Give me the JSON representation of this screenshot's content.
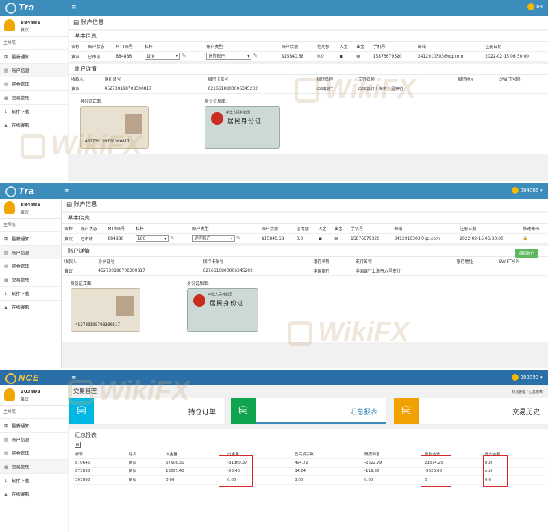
{
  "panel1": {
    "brand": "Tra",
    "user_top": "88",
    "sidebar": {
      "user_id": "884886",
      "user_name": "黄议",
      "nav_header": "主导航",
      "items": [
        {
          "icon": "bullhorn-icon",
          "glyph": "◘",
          "label": "最新通知"
        },
        {
          "icon": "id-card-icon",
          "glyph": "▤",
          "label": "账户信息"
        },
        {
          "icon": "money-icon",
          "glyph": "▥",
          "label": "资金管理"
        },
        {
          "icon": "chart-icon",
          "glyph": "▦",
          "label": "交易管理"
        },
        {
          "icon": "download-icon",
          "glyph": "↓",
          "label": "软件下载"
        },
        {
          "icon": "user-icon",
          "glyph": "▲",
          "label": "在线客服"
        }
      ]
    },
    "page_title": "账户信息",
    "basic": {
      "title": "基本信息",
      "headers": [
        "名称",
        "账户状态",
        "MT4账号",
        "杠杆",
        "账户类型",
        "账户余额",
        "信用额",
        "入金",
        "出金",
        "手机号",
        "邮箱",
        "注册日期"
      ],
      "row": {
        "name": "黄议",
        "status": "已审核",
        "mt4": "884886",
        "leverage": "100",
        "type": "迷你账户",
        "balance": "$15840.68",
        "credit": "0.0",
        "phone": "15876679320",
        "email": "3412910303@qq.com",
        "reg": "2022-02-15 06:30:00"
      }
    },
    "detail": {
      "title": "账户详情",
      "headers": [
        "收款人",
        "身份证号",
        "银行卡账号",
        "银行名称",
        "支行名称",
        "银行地址",
        "SWIFT号码"
      ],
      "row": {
        "payee": "黄议",
        "idno": "452730198708300817",
        "card": "6216610800006345202",
        "bank": "中国银行",
        "branch": "中国银行上海市六里支行",
        "addr": "",
        "swift": ""
      },
      "front_label": "身份证正面:",
      "back_label": "身份证反面:",
      "card_number": "452730198708300817",
      "back_title": "居民身份证",
      "back_sub": "中华人民共和国"
    }
  },
  "panel2": {
    "brand": "Tra",
    "user_top": "884886",
    "sidebar": {
      "user_id": "884886",
      "user_name": "黄议",
      "nav_header": "主导航",
      "items": [
        {
          "icon": "bullhorn-icon",
          "glyph": "◘",
          "label": "最新通知"
        },
        {
          "icon": "id-card-icon",
          "glyph": "▤",
          "label": "账户信息"
        },
        {
          "icon": "money-icon",
          "glyph": "▥",
          "label": "资金管理"
        },
        {
          "icon": "chart-icon",
          "glyph": "▦",
          "label": "交易管理"
        },
        {
          "icon": "download-icon",
          "glyph": "↓",
          "label": "软件下载"
        },
        {
          "icon": "user-icon",
          "glyph": "▲",
          "label": "在线客服"
        }
      ]
    },
    "page_title": "账户信息",
    "basic": {
      "title": "基本信息",
      "headers": [
        "名称",
        "账户状态",
        "MT4账号",
        "杠杆",
        "账户类型",
        "账户余额",
        "信用额",
        "入金",
        "出金",
        "手机号",
        "邮箱",
        "注册日期",
        "修改密码"
      ],
      "row": {
        "name": "黄议",
        "status": "已审核",
        "mt4": "884886",
        "leverage": "100",
        "type": "迷你账户",
        "balance": "$15840.68",
        "credit": "0.0",
        "phone": "15876679320",
        "email": "3412910303@qq.com",
        "reg": "2022-02-15 06:30:00"
      }
    },
    "detail": {
      "title": "账户详情",
      "button": "编辑账户",
      "headers": [
        "收款人",
        "身份证号",
        "银行卡账号",
        "银行名称",
        "支行名称",
        "银行地址",
        "SWIFT号码"
      ],
      "row": {
        "payee": "黄议",
        "idno": "452730198708300817",
        "card": "6216610800006345202",
        "bank": "中国银行",
        "branch": "中国银行上海市六里支行"
      },
      "front_label": "身份证正面:",
      "back_label": "身份证反面:",
      "card_number": "452730198708300817",
      "back_title": "居民身份证",
      "back_sub": "中华人民共和国"
    }
  },
  "panel3": {
    "brand": "NCE",
    "user_top": "303893",
    "sidebar": {
      "user_id": "303893",
      "user_name": "黄议",
      "nav_header": "主导航",
      "items": [
        {
          "icon": "bullhorn-icon",
          "glyph": "◘",
          "label": "最新通知"
        },
        {
          "icon": "id-card-icon",
          "glyph": "▤",
          "label": "账户信息"
        },
        {
          "icon": "money-icon",
          "glyph": "▥",
          "label": "资金管理"
        },
        {
          "icon": "chart-icon",
          "glyph": "▦",
          "label": "交易管理"
        },
        {
          "icon": "download-icon",
          "glyph": "↓",
          "label": "软件下载"
        },
        {
          "icon": "user-icon",
          "glyph": "▲",
          "label": "在线客服"
        }
      ]
    },
    "page_title": "交易管理",
    "breadcrumb": "交易管理 / 汇总报表",
    "tiles": [
      "持仓订单",
      "汇总报表",
      "交易历史"
    ],
    "report": {
      "title": "汇总报表",
      "headers": [
        "帐号",
        "姓名",
        "入金量",
        "出金量",
        "已完成手数",
        "隔夜利息",
        "盈利合计",
        "账户余额"
      ],
      "rows": [
        [
          "870645",
          "黄议",
          "67606.30",
          "-31360.37",
          "494.72",
          "-2522.79",
          "21574.25",
          "null"
        ],
        [
          "873833",
          "黄议",
          "13097.40",
          "-53.40",
          "34.24",
          "-119.56",
          "-9625.03",
          "null"
        ],
        [
          "303893",
          "黄议",
          "0.00",
          "0.00",
          "0.00",
          "0.00",
          "0",
          "0.0"
        ]
      ]
    }
  },
  "watermark": "WikiFX"
}
